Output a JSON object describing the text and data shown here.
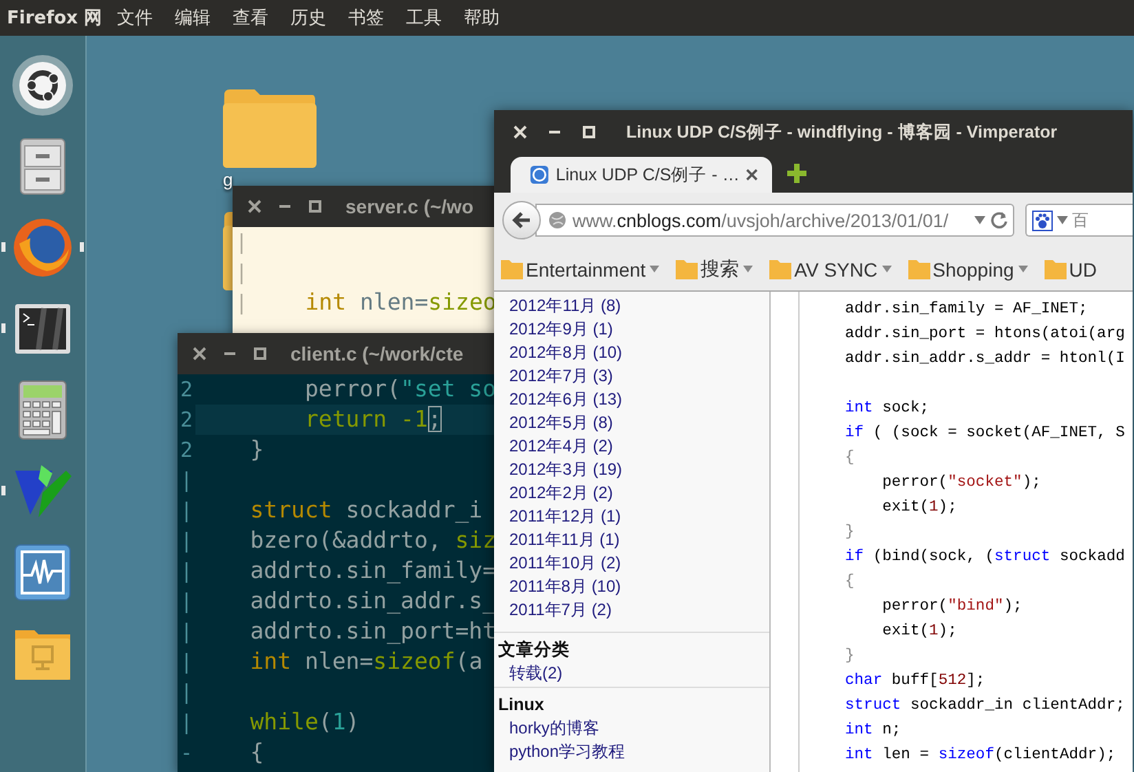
{
  "top_panel": {
    "app_title": "Firefox 网",
    "menu": [
      "文件",
      "编辑",
      "查看",
      "历史",
      "书签",
      "工具",
      "帮助"
    ]
  },
  "launcher": [
    {
      "kind": "dash",
      "running": false,
      "focused": false
    },
    {
      "kind": "files",
      "running": false,
      "focused": false
    },
    {
      "kind": "firefox",
      "running": true,
      "focused": true
    },
    {
      "kind": "terminal",
      "running": true,
      "focused": false
    },
    {
      "kind": "calculator",
      "running": false,
      "focused": false
    },
    {
      "kind": "vim",
      "running": true,
      "focused": false
    },
    {
      "kind": "monitor",
      "running": false,
      "focused": false
    },
    {
      "kind": "folder",
      "running": false,
      "focused": false
    }
  ],
  "desktop_icons": [
    {
      "kind": "folder",
      "label": "g"
    },
    {
      "kind": "folder"
    }
  ],
  "server_window": {
    "title": "server.c (~/wo",
    "lines": [
      {
        "kind": "blank",
        "gutter": "|"
      },
      {
        "kind": "blank",
        "gutter": "|"
      },
      {
        "kind": "code",
        "gutter": "|",
        "tokens": [
          {
            "text": "    int",
            "kind": "type"
          },
          {
            "text": " nlen=",
            "kind": "plain"
          },
          {
            "text": "sizeo",
            "kind": "statement"
          }
        ]
      }
    ]
  },
  "client_window": {
    "title": "client.c (~/work/cte",
    "lines": [
      {
        "kind": "code",
        "gutter": "2",
        "current": false,
        "tokens": [
          {
            "text": "        perror(",
            "kind": "plain"
          },
          {
            "text": "\"set so",
            "kind": "string"
          }
        ]
      },
      {
        "kind": "code",
        "gutter": "2",
        "current": true,
        "tokens": [
          {
            "text": "        return -1",
            "kind": "statement"
          },
          {
            "text": ";",
            "kind": "cursor"
          }
        ]
      },
      {
        "kind": "code",
        "gutter": "2",
        "current": false,
        "tokens": [
          {
            "text": "    }",
            "kind": "plain"
          }
        ]
      },
      {
        "kind": "blank",
        "gutter": "|",
        "current": false
      },
      {
        "kind": "code",
        "gutter": "|",
        "current": false,
        "tokens": [
          {
            "text": "    struct",
            "kind": "type"
          },
          {
            "text": " sockaddr_i",
            "kind": "plain"
          }
        ]
      },
      {
        "kind": "code",
        "gutter": "|",
        "current": false,
        "tokens": [
          {
            "text": "    bzero(&addrto, ",
            "kind": "plain"
          },
          {
            "text": "siz",
            "kind": "statement"
          }
        ]
      },
      {
        "kind": "code",
        "gutter": "|",
        "current": false,
        "tokens": [
          {
            "text": "    addrto.sin_family=",
            "kind": "plain"
          }
        ]
      },
      {
        "kind": "code",
        "gutter": "|",
        "current": false,
        "tokens": [
          {
            "text": "    addrto.sin_addr.s_",
            "kind": "plain"
          }
        ]
      },
      {
        "kind": "code",
        "gutter": "|",
        "current": false,
        "tokens": [
          {
            "text": "    addrto.sin_port=ht",
            "kind": "plain"
          }
        ]
      },
      {
        "kind": "code",
        "gutter": "|",
        "current": false,
        "tokens": [
          {
            "text": "    int",
            "kind": "type"
          },
          {
            "text": " nlen=",
            "kind": "plain"
          },
          {
            "text": "sizeof",
            "kind": "statement"
          },
          {
            "text": "(a",
            "kind": "plain"
          }
        ]
      },
      {
        "kind": "blank",
        "gutter": "|",
        "current": false
      },
      {
        "kind": "code",
        "gutter": "|",
        "current": false,
        "tokens": [
          {
            "text": "    while",
            "kind": "statement"
          },
          {
            "text": "(",
            "kind": "plain"
          },
          {
            "text": "1",
            "kind": "number"
          },
          {
            "text": ")",
            "kind": "plain"
          }
        ]
      },
      {
        "kind": "code",
        "gutter": "-",
        "current": false,
        "tokens": [
          {
            "text": "    {",
            "kind": "plain"
          }
        ]
      }
    ]
  },
  "browser": {
    "title": "Linux UDP C/S例子 - windflying - 博客园 - Vimperator",
    "tabs": [
      {
        "label": "Linux UDP C/S例子 - …",
        "selected": true
      }
    ],
    "url": {
      "prefix": "www.",
      "domain": "cnblogs.com",
      "path": "/uvsjoh/archive/2013/01/01/"
    },
    "search": {
      "value": "百"
    },
    "bookmarks": [
      {
        "label": "Entertainment",
        "menu": true
      },
      {
        "label": "搜索",
        "menu": true
      },
      {
        "label": "AV SYNC",
        "menu": true
      },
      {
        "label": "Shopping",
        "menu": true
      },
      {
        "label": "UD",
        "menu": false
      }
    ],
    "sidebar": [
      {
        "links": [
          "2012年11月 (8)",
          "2012年9月 (1)",
          "2012年8月 (10)",
          "2012年7月 (3)",
          "2012年6月 (13)",
          "2012年5月 (8)",
          "2012年4月 (2)",
          "2012年3月 (19)",
          "2012年2月 (2)",
          "2011年12月 (1)",
          "2011年11月 (1)",
          "2011年10月 (2)",
          "2011年8月 (10)",
          "2011年7月 (2)"
        ]
      },
      {
        "heading": "文章分类",
        "links": [
          "转载(2)"
        ]
      },
      {
        "heading": "Linux",
        "links": [
          "horky的博客",
          "python学习教程"
        ]
      }
    ],
    "code": [
      [
        {
          "text": "addr.sin_family = AF_INET;",
          "kind": "plain"
        }
      ],
      [
        {
          "text": "addr.sin_port = htons(atoi(arg",
          "kind": "plain"
        }
      ],
      [
        {
          "text": "addr.sin_addr.s_addr = htonl(I",
          "kind": "plain"
        }
      ],
      [
        {
          "kind": "blank"
        }
      ],
      [
        {
          "text": "int",
          "kind": "keyword"
        },
        {
          "text": " sock;",
          "kind": "plain"
        }
      ],
      [
        {
          "text": "if",
          "kind": "keyword"
        },
        {
          "text": " ( (sock = socket(AF_INET, S",
          "kind": "plain"
        }
      ],
      [
        {
          "text": "{",
          "kind": "punct"
        }
      ],
      [
        {
          "text": "    perror(",
          "kind": "plain"
        },
        {
          "text": "\"socket\"",
          "kind": "string"
        },
        {
          "text": ");",
          "kind": "plain"
        }
      ],
      [
        {
          "text": "    exit(",
          "kind": "plain"
        },
        {
          "text": "1",
          "kind": "number"
        },
        {
          "text": ");",
          "kind": "plain"
        }
      ],
      [
        {
          "text": "}",
          "kind": "punct"
        }
      ],
      [
        {
          "text": "if",
          "kind": "keyword"
        },
        {
          "text": " (bind(sock, (",
          "kind": "plain"
        },
        {
          "text": "struct",
          "kind": "keyword"
        },
        {
          "text": " sockadd",
          "kind": "plain"
        }
      ],
      [
        {
          "text": "{",
          "kind": "punct"
        }
      ],
      [
        {
          "text": "    perror(",
          "kind": "plain"
        },
        {
          "text": "\"bind\"",
          "kind": "string"
        },
        {
          "text": ");",
          "kind": "plain"
        }
      ],
      [
        {
          "text": "    exit(",
          "kind": "plain"
        },
        {
          "text": "1",
          "kind": "number"
        },
        {
          "text": ");",
          "kind": "plain"
        }
      ],
      [
        {
          "text": "}",
          "kind": "punct"
        }
      ],
      [
        {
          "text": "char",
          "kind": "keyword"
        },
        {
          "text": " buff[",
          "kind": "plain"
        },
        {
          "text": "512",
          "kind": "number"
        },
        {
          "text": "];",
          "kind": "plain"
        }
      ],
      [
        {
          "text": "struct",
          "kind": "keyword"
        },
        {
          "text": " sockaddr_in clientAddr;",
          "kind": "plain"
        }
      ],
      [
        {
          "text": "int",
          "kind": "keyword"
        },
        {
          "text": " n;",
          "kind": "plain"
        }
      ],
      [
        {
          "text": "int",
          "kind": "keyword"
        },
        {
          "text": " len = ",
          "kind": "plain"
        },
        {
          "text": "sizeof",
          "kind": "keyword"
        },
        {
          "text": "(clientAddr);",
          "kind": "plain"
        }
      ]
    ]
  }
}
